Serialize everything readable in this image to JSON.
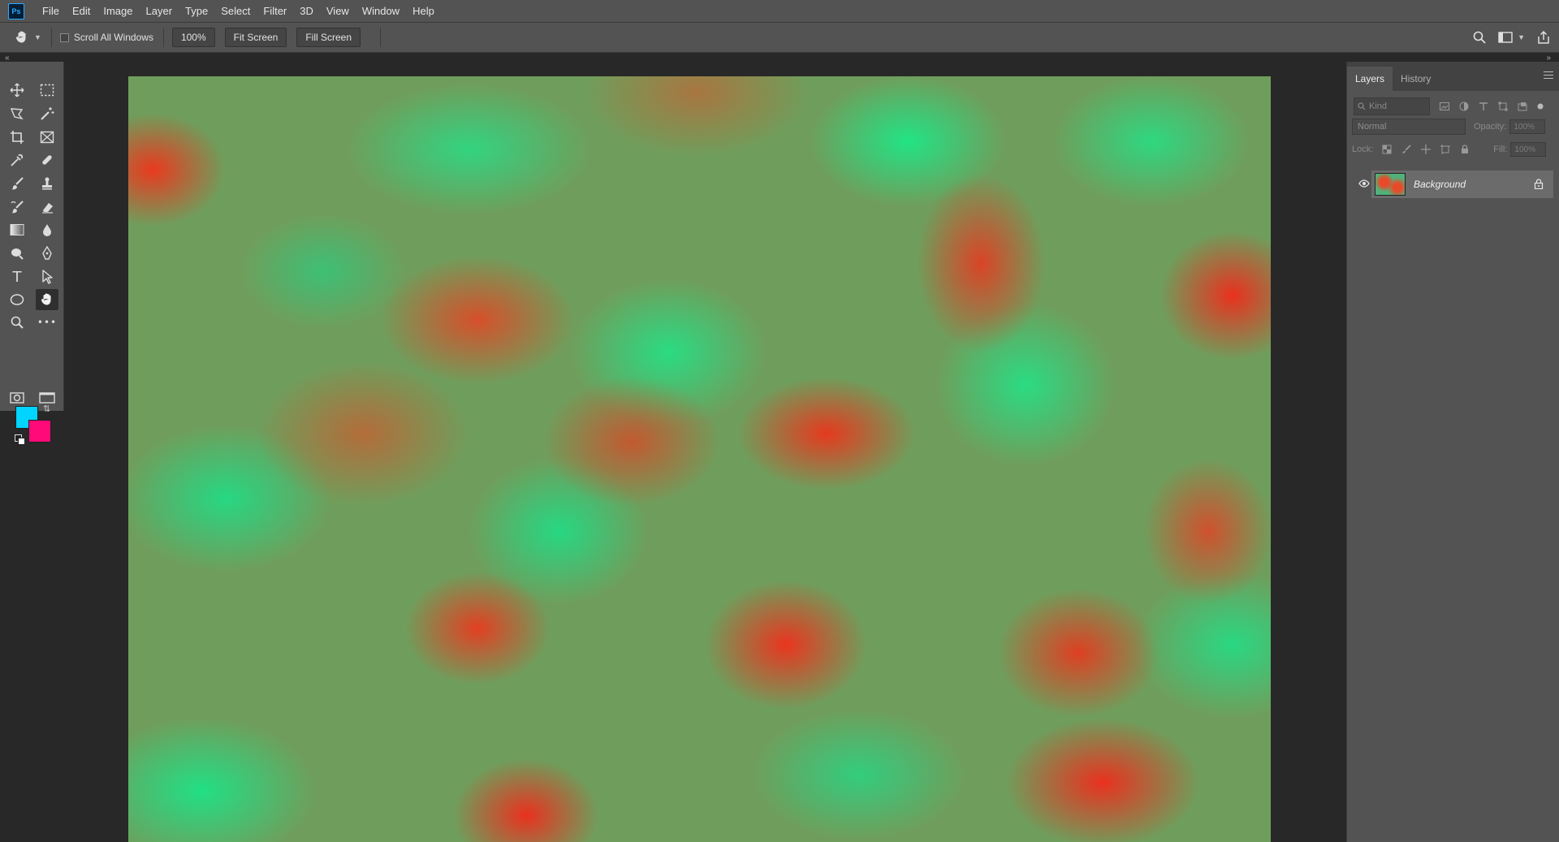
{
  "app": {
    "logo_text": "Ps",
    "colors": {
      "chrome": "#535353",
      "workspace": "#282828",
      "accent": "#31a8ff"
    }
  },
  "menu": [
    "File",
    "Edit",
    "Image",
    "Layer",
    "Type",
    "Select",
    "Filter",
    "3D",
    "View",
    "Window",
    "Help"
  ],
  "options": {
    "tool_icon": "hand-icon",
    "scroll_all_windows_label": "Scroll All Windows",
    "scroll_all_windows_checked": false,
    "zoom_value": "100%",
    "fit_screen_label": "Fit Screen",
    "fill_screen_label": "Fill Screen",
    "right_icons": [
      "search-icon",
      "workspace-icon",
      "share-icon"
    ]
  },
  "tools": {
    "items": [
      "move-tool",
      "marquee-tool",
      "lasso-tool",
      "magic-wand-tool",
      "crop-tool",
      "frame-tool",
      "eyedropper-tool",
      "healing-brush-tool",
      "brush-tool",
      "clone-stamp-tool",
      "history-brush-tool",
      "eraser-tool",
      "gradient-tool",
      "blur-tool",
      "dodge-tool",
      "pen-tool",
      "type-tool",
      "path-selection-tool",
      "ellipse-tool",
      "hand-tool",
      "zoom-tool",
      "more-tools"
    ],
    "active_tool": "hand-tool",
    "type_tool_glyph": "T",
    "more_tools_glyph": "•••",
    "foreground_color": "#00d4ff",
    "background_color": "#ff0a78"
  },
  "layers_panel": {
    "tabs": [
      "Layers",
      "History"
    ],
    "active_tab": "Layers",
    "filter_placeholder": "Kind",
    "blend_mode": "Normal",
    "opacity_label": "Opacity:",
    "opacity_value": "100%",
    "lock_label": "Lock:",
    "fill_label": "Fill:",
    "fill_value": "100%",
    "layers": [
      {
        "name": "Background",
        "visible": true,
        "locked": true
      }
    ]
  }
}
